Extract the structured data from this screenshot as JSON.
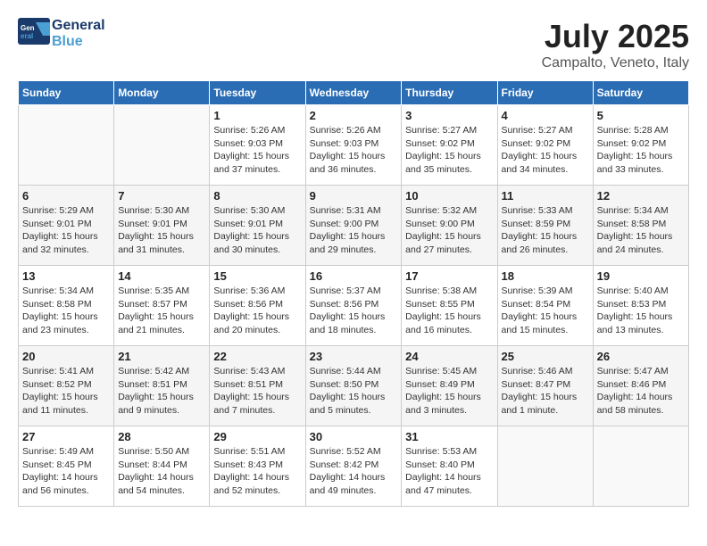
{
  "header": {
    "logo_line1": "General",
    "logo_line2": "Blue",
    "month": "July 2025",
    "location": "Campalto, Veneto, Italy"
  },
  "weekdays": [
    "Sunday",
    "Monday",
    "Tuesday",
    "Wednesday",
    "Thursday",
    "Friday",
    "Saturday"
  ],
  "weeks": [
    [
      {
        "day": "",
        "info": ""
      },
      {
        "day": "",
        "info": ""
      },
      {
        "day": "1",
        "info": "Sunrise: 5:26 AM\nSunset: 9:03 PM\nDaylight: 15 hours and 37 minutes."
      },
      {
        "day": "2",
        "info": "Sunrise: 5:26 AM\nSunset: 9:03 PM\nDaylight: 15 hours and 36 minutes."
      },
      {
        "day": "3",
        "info": "Sunrise: 5:27 AM\nSunset: 9:02 PM\nDaylight: 15 hours and 35 minutes."
      },
      {
        "day": "4",
        "info": "Sunrise: 5:27 AM\nSunset: 9:02 PM\nDaylight: 15 hours and 34 minutes."
      },
      {
        "day": "5",
        "info": "Sunrise: 5:28 AM\nSunset: 9:02 PM\nDaylight: 15 hours and 33 minutes."
      }
    ],
    [
      {
        "day": "6",
        "info": "Sunrise: 5:29 AM\nSunset: 9:01 PM\nDaylight: 15 hours and 32 minutes."
      },
      {
        "day": "7",
        "info": "Sunrise: 5:30 AM\nSunset: 9:01 PM\nDaylight: 15 hours and 31 minutes."
      },
      {
        "day": "8",
        "info": "Sunrise: 5:30 AM\nSunset: 9:01 PM\nDaylight: 15 hours and 30 minutes."
      },
      {
        "day": "9",
        "info": "Sunrise: 5:31 AM\nSunset: 9:00 PM\nDaylight: 15 hours and 29 minutes."
      },
      {
        "day": "10",
        "info": "Sunrise: 5:32 AM\nSunset: 9:00 PM\nDaylight: 15 hours and 27 minutes."
      },
      {
        "day": "11",
        "info": "Sunrise: 5:33 AM\nSunset: 8:59 PM\nDaylight: 15 hours and 26 minutes."
      },
      {
        "day": "12",
        "info": "Sunrise: 5:34 AM\nSunset: 8:58 PM\nDaylight: 15 hours and 24 minutes."
      }
    ],
    [
      {
        "day": "13",
        "info": "Sunrise: 5:34 AM\nSunset: 8:58 PM\nDaylight: 15 hours and 23 minutes."
      },
      {
        "day": "14",
        "info": "Sunrise: 5:35 AM\nSunset: 8:57 PM\nDaylight: 15 hours and 21 minutes."
      },
      {
        "day": "15",
        "info": "Sunrise: 5:36 AM\nSunset: 8:56 PM\nDaylight: 15 hours and 20 minutes."
      },
      {
        "day": "16",
        "info": "Sunrise: 5:37 AM\nSunset: 8:56 PM\nDaylight: 15 hours and 18 minutes."
      },
      {
        "day": "17",
        "info": "Sunrise: 5:38 AM\nSunset: 8:55 PM\nDaylight: 15 hours and 16 minutes."
      },
      {
        "day": "18",
        "info": "Sunrise: 5:39 AM\nSunset: 8:54 PM\nDaylight: 15 hours and 15 minutes."
      },
      {
        "day": "19",
        "info": "Sunrise: 5:40 AM\nSunset: 8:53 PM\nDaylight: 15 hours and 13 minutes."
      }
    ],
    [
      {
        "day": "20",
        "info": "Sunrise: 5:41 AM\nSunset: 8:52 PM\nDaylight: 15 hours and 11 minutes."
      },
      {
        "day": "21",
        "info": "Sunrise: 5:42 AM\nSunset: 8:51 PM\nDaylight: 15 hours and 9 minutes."
      },
      {
        "day": "22",
        "info": "Sunrise: 5:43 AM\nSunset: 8:51 PM\nDaylight: 15 hours and 7 minutes."
      },
      {
        "day": "23",
        "info": "Sunrise: 5:44 AM\nSunset: 8:50 PM\nDaylight: 15 hours and 5 minutes."
      },
      {
        "day": "24",
        "info": "Sunrise: 5:45 AM\nSunset: 8:49 PM\nDaylight: 15 hours and 3 minutes."
      },
      {
        "day": "25",
        "info": "Sunrise: 5:46 AM\nSunset: 8:47 PM\nDaylight: 15 hours and 1 minute."
      },
      {
        "day": "26",
        "info": "Sunrise: 5:47 AM\nSunset: 8:46 PM\nDaylight: 14 hours and 58 minutes."
      }
    ],
    [
      {
        "day": "27",
        "info": "Sunrise: 5:49 AM\nSunset: 8:45 PM\nDaylight: 14 hours and 56 minutes."
      },
      {
        "day": "28",
        "info": "Sunrise: 5:50 AM\nSunset: 8:44 PM\nDaylight: 14 hours and 54 minutes."
      },
      {
        "day": "29",
        "info": "Sunrise: 5:51 AM\nSunset: 8:43 PM\nDaylight: 14 hours and 52 minutes."
      },
      {
        "day": "30",
        "info": "Sunrise: 5:52 AM\nSunset: 8:42 PM\nDaylight: 14 hours and 49 minutes."
      },
      {
        "day": "31",
        "info": "Sunrise: 5:53 AM\nSunset: 8:40 PM\nDaylight: 14 hours and 47 minutes."
      },
      {
        "day": "",
        "info": ""
      },
      {
        "day": "",
        "info": ""
      }
    ]
  ]
}
